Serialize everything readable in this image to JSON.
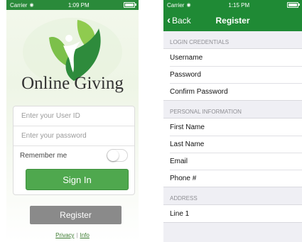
{
  "left": {
    "status": {
      "carrier": "Carrier",
      "time": "1:09 PM"
    },
    "brand": "Online Giving",
    "fields": {
      "user_id_placeholder": "Enter your User ID",
      "password_placeholder": "Enter your password"
    },
    "remember_label": "Remember me",
    "signin_label": "Sign In",
    "register_label": "Register",
    "links": {
      "privacy": "Privacy",
      "separator": "|",
      "info": "Info"
    }
  },
  "right": {
    "status": {
      "carrier": "Carrier",
      "time": "1:15 PM"
    },
    "nav": {
      "back_label": "Back",
      "title": "Register"
    },
    "sections": [
      {
        "header": "LOGIN CREDENTIALS",
        "rows": [
          "Username",
          "Password",
          "Confirm Password"
        ]
      },
      {
        "header": "PERSONAL INFORMATION",
        "rows": [
          "First Name",
          "Last Name",
          "Email",
          "Phone #"
        ]
      },
      {
        "header": "ADDRESS",
        "rows": [
          "Line 1"
        ]
      }
    ]
  },
  "colors": {
    "green": "#4fa84e",
    "dark_green": "#1f8a35",
    "grey_button": "#8a8a8a"
  },
  "icons": [
    "wifi-icon",
    "battery-icon",
    "chevron-left-icon",
    "giving-person-leaf-logo"
  ]
}
